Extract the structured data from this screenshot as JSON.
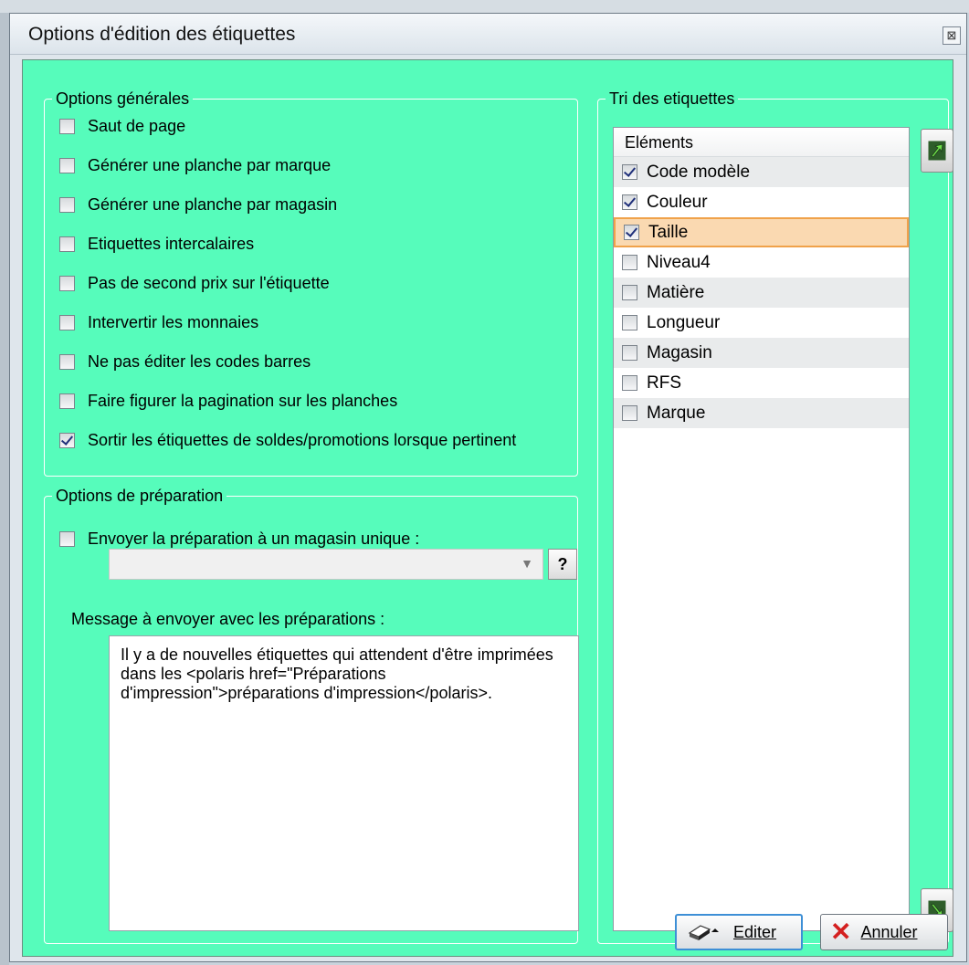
{
  "window": {
    "title": "Options d'édition des étiquettes",
    "close_glyph": "⊠"
  },
  "general_options": {
    "legend": "Options générales",
    "items": [
      {
        "label": "Saut de page",
        "checked": false
      },
      {
        "label": "Générer une planche par marque",
        "checked": false
      },
      {
        "label": "Générer une planche par magasin",
        "checked": false
      },
      {
        "label": "Etiquettes intercalaires",
        "checked": false
      },
      {
        "label": "Pas de second prix sur l'étiquette",
        "checked": false
      },
      {
        "label": "Intervertir les monnaies",
        "checked": false
      },
      {
        "label": "Ne pas éditer les codes barres",
        "checked": false
      },
      {
        "label": "Faire figurer la pagination sur les planches",
        "checked": false
      },
      {
        "label": "Sortir les étiquettes de soldes/promotions lorsque pertinent",
        "checked": true
      }
    ]
  },
  "preparation_options": {
    "legend": "Options de préparation",
    "single_store": {
      "label": "Envoyer la préparation à un magasin unique :",
      "checked": false
    },
    "store_select": {
      "value": "",
      "arrow_glyph": "▼"
    },
    "help_button": "?",
    "message_label": "Message à envoyer avec les préparations :",
    "message_text": "Il y a de nouvelles étiquettes qui attendent d'être imprimées dans les <polaris href=\"Préparations d'impression\">préparations d'impression</polaris>."
  },
  "sort_labels": {
    "legend": "Tri des etiquettes",
    "column_header": "Eléments",
    "items": [
      {
        "label": "Code modèle",
        "checked": true
      },
      {
        "label": "Couleur",
        "checked": true
      },
      {
        "label": "Taille",
        "checked": true,
        "selected": true
      },
      {
        "label": "Niveau4",
        "checked": false
      },
      {
        "label": "Matière",
        "checked": false
      },
      {
        "label": "Longueur",
        "checked": false
      },
      {
        "label": "Magasin",
        "checked": false
      },
      {
        "label": "RFS",
        "checked": false
      },
      {
        "label": "Marque",
        "checked": false
      }
    ],
    "move_up_icon": "arrow-up-icon",
    "move_down_icon": "arrow-down-icon"
  },
  "actions": {
    "edit_label": "Editer",
    "cancel_label": "Annuler"
  },
  "colors": {
    "client_background": "#56fcbb",
    "selection_fill": "#fad9b1",
    "selection_border": "#f0a24a",
    "cancel_x": "#d42020"
  }
}
